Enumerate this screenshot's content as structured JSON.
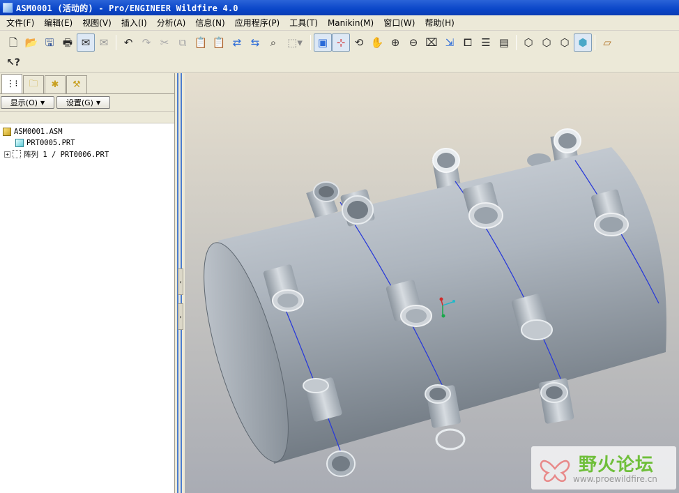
{
  "window": {
    "title": "ASM0001 (活动的) - Pro/ENGINEER Wildfire 4.0"
  },
  "menubar": {
    "items": [
      "文件(F)",
      "编辑(E)",
      "视图(V)",
      "插入(I)",
      "分析(A)",
      "信息(N)",
      "应用程序(P)",
      "工具(T)",
      "Manikin(M)",
      "窗口(W)",
      "帮助(H)"
    ]
  },
  "toolbar": {
    "buttons": [
      "new-icon",
      "open-icon",
      "save-icon",
      "print-icon",
      "email-icon",
      "email-link-icon",
      "undo-icon",
      "redo-icon",
      "cut-icon",
      "copy-icon",
      "paste-icon",
      "paste-special-icon",
      "regenerate-icon",
      "regenerate-manager-icon",
      "find-icon",
      "select-box-icon",
      "repaint-icon",
      "spin-center-icon",
      "orient-mode-icon",
      "pan-icon",
      "zoom-in-icon",
      "zoom-out-icon",
      "refit-icon",
      "reorient-icon",
      "saved-views-icon",
      "layers-icon",
      "view-manager-icon",
      "wireframe-icon",
      "hidden-line-icon",
      "no-hidden-icon",
      "shading-icon",
      "datum-planes-icon"
    ]
  },
  "toolbar2": {
    "buttons": [
      "context-help-icon"
    ]
  },
  "navigator": {
    "tabs": [
      "model-tree-tab",
      "folder-browser-tab",
      "favorites-tab",
      "connections-tab"
    ],
    "show_label": "显示(O)",
    "settings_label": "设置(G)"
  },
  "model_tree": {
    "root": "ASM0001.ASM",
    "items": [
      {
        "label": "PRT0005.PRT",
        "type": "part",
        "expandable": false
      },
      {
        "label": "阵列 1 / PRT0006.PRT",
        "type": "pattern",
        "expandable": true
      }
    ]
  },
  "viewport": {
    "background_top": "#e6dfcf",
    "background_bottom": "#a9acb4",
    "model_color": "#b7bfc8",
    "edge_color": "#2a3bd8"
  },
  "watermark": {
    "title": "野火论坛",
    "url": "www.proewildfire.cn"
  }
}
